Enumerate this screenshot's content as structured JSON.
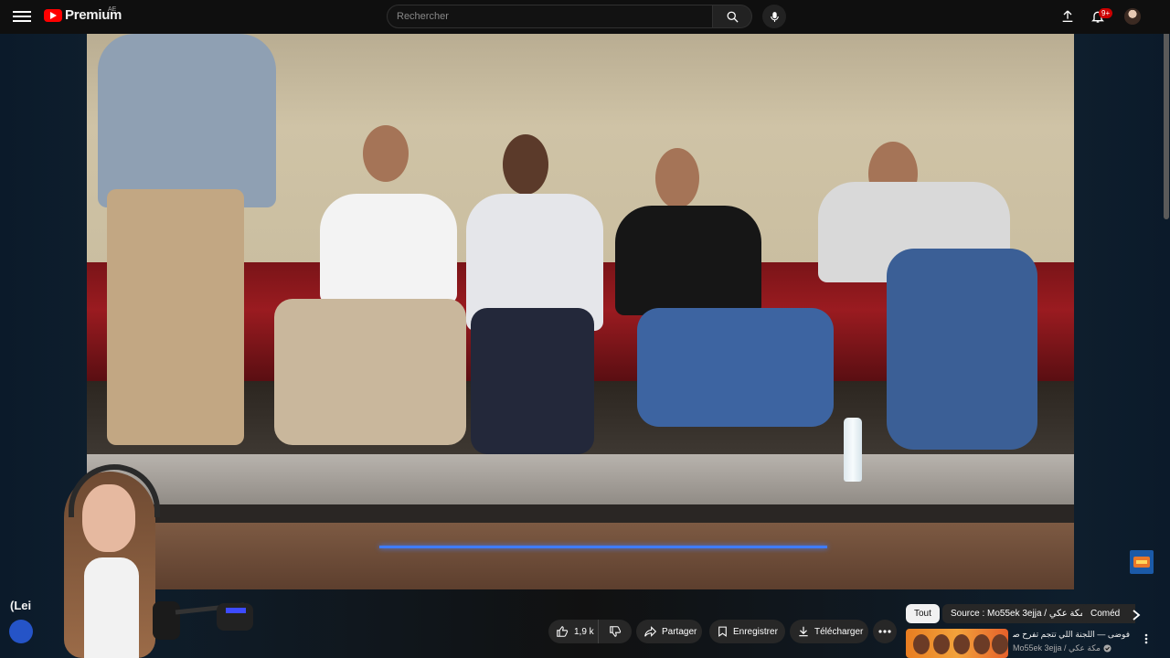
{
  "header": {
    "logo_text": "Premium",
    "country_code": "AE",
    "search_placeholder": "Rechercher",
    "notification_count": "9+"
  },
  "video": {
    "title_partial": "(Lei"
  },
  "actions": {
    "like_count": "1,9 k",
    "share_label": "Partager",
    "save_label": "Enregistrer",
    "download_label": "Télécharger"
  },
  "chips": [
    {
      "label": "Tout",
      "active": true
    },
    {
      "label": "Source : Mo55ek 3ejja / مكة عكي"
    },
    {
      "label": "Coméd"
    }
  ],
  "recommended": {
    "title": "فوضى — اللجنة اللي تتجم تفرح صدقاتك",
    "channel": "Mo55ek 3ejja / مكة عكي"
  },
  "colors": {
    "brand_red": "#ff0000",
    "background": "#0f0f0f",
    "button_bg": "#272727",
    "active_chip": "#f1f1f1"
  }
}
